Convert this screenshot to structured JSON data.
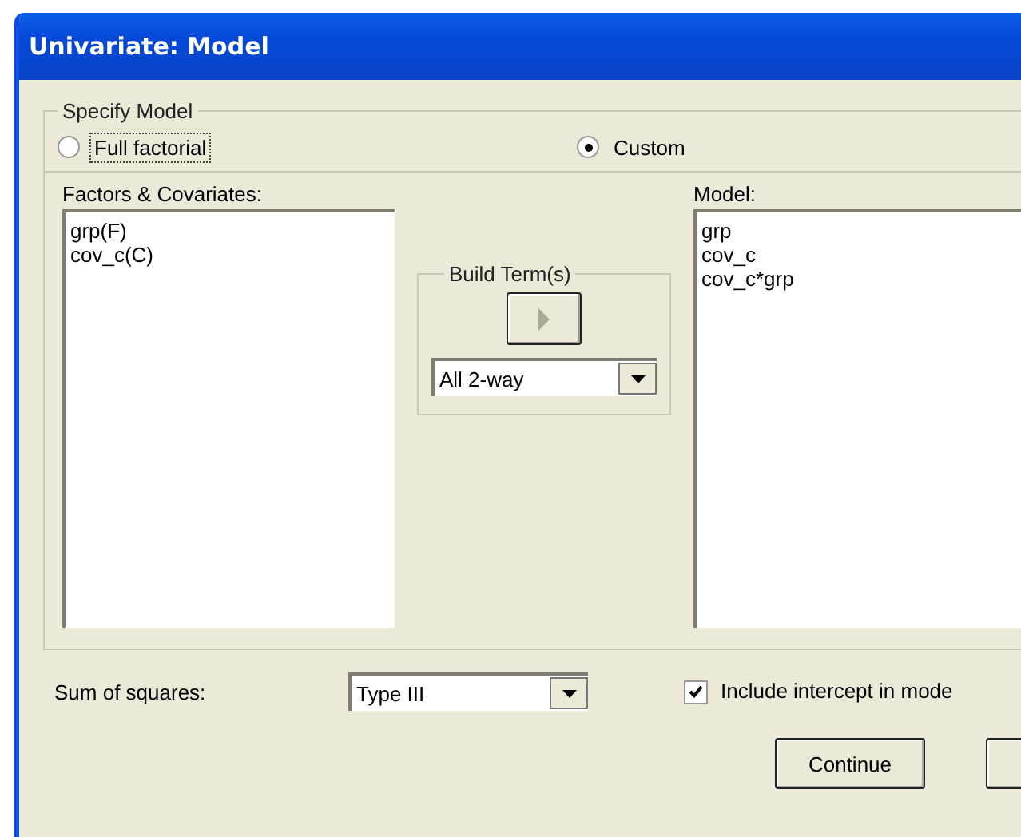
{
  "window": {
    "title": "Univariate: Model"
  },
  "specify_model": {
    "legend": "Specify Model",
    "options": [
      {
        "label": "Full factorial",
        "selected": false,
        "focused": true
      },
      {
        "label": "Custom",
        "selected": true,
        "focused": false
      }
    ]
  },
  "factors_covariates": {
    "label": "Factors & Covariates:",
    "items": [
      "grp(F)",
      "cov_c(C)"
    ]
  },
  "build_terms": {
    "legend": "Build Term(s)",
    "type_value": "All 2-way"
  },
  "model": {
    "label": "Model:",
    "items": [
      "grp",
      "cov_c",
      "cov_c*grp"
    ]
  },
  "sum_of_squares": {
    "label": "Sum of squares:",
    "value": "Type III"
  },
  "include_intercept": {
    "label": "Include intercept in mode",
    "checked": true
  },
  "buttons": [
    {
      "label": "Continue"
    }
  ],
  "cut_off_button": true
}
